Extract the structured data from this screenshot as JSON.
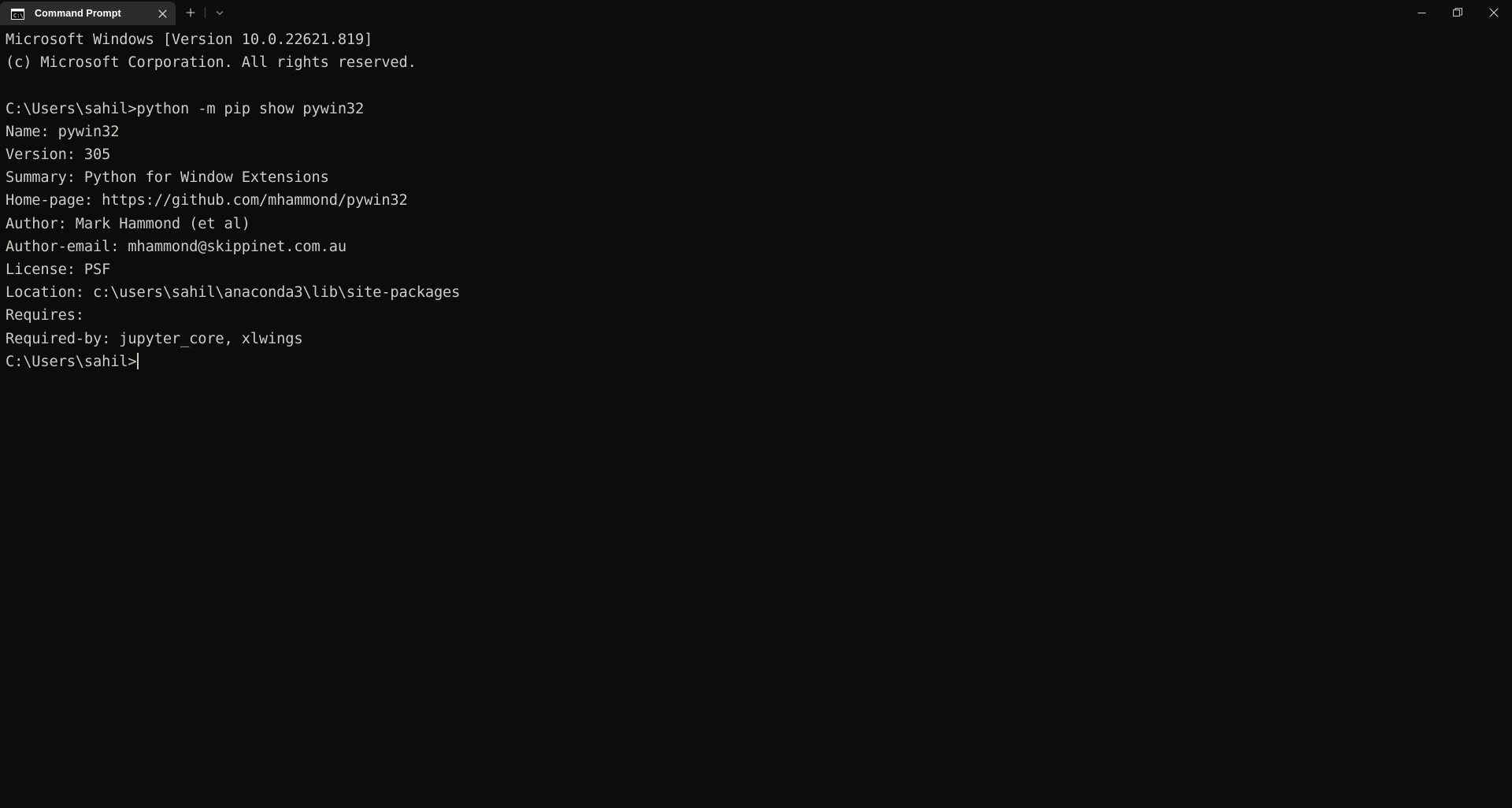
{
  "window": {
    "app": "Windows Terminal",
    "controls": {
      "minimize_label": "Minimize",
      "restore_label": "Restore Down",
      "close_label": "Close"
    }
  },
  "tabbar": {
    "tabs": [
      {
        "title": "Command Prompt",
        "icon": "command-prompt-icon",
        "close_label": "Close tab",
        "active": true
      }
    ],
    "new_tab_label": "+",
    "dropdown_label": "Open a new tab",
    "colors": {
      "active_tab_bg": "#2c2c2c",
      "titlebar_bg": "#0d0d0d"
    }
  },
  "terminal": {
    "colors": {
      "background": "#0c0c0c",
      "foreground": "#ccccc8"
    },
    "prompt": "C:\\Users\\sahil>",
    "cursor_visible": true,
    "lines": [
      "Microsoft Windows [Version 10.0.22621.819]",
      "(c) Microsoft Corporation. All rights reserved.",
      "",
      "C:\\Users\\sahil>python -m pip show pywin32",
      "Name: pywin32",
      "Version: 305",
      "Summary: Python for Window Extensions",
      "Home-page: https://github.com/mhammond/pywin32",
      "Author: Mark Hammond (et al)",
      "Author-email: mhammond@skippinet.com.au",
      "License: PSF",
      "Location: c:\\users\\sahil\\anaconda3\\lib\\site-packages",
      "Requires:",
      "Required-by: jupyter_core, xlwings",
      ""
    ],
    "command": {
      "executable": "python",
      "full": "python -m pip show pywin32"
    },
    "package_info": {
      "Name": "pywin32",
      "Version": "305",
      "Summary": "Python for Window Extensions",
      "Home-page": "https://github.com/mhammond/pywin32",
      "Author": "Mark Hammond (et al)",
      "Author-email": "mhammond@skippinet.com.au",
      "License": "PSF",
      "Location": "c:\\users\\sahil\\anaconda3\\lib\\site-packages",
      "Requires": "",
      "Required-by": "jupyter_core, xlwings"
    }
  }
}
